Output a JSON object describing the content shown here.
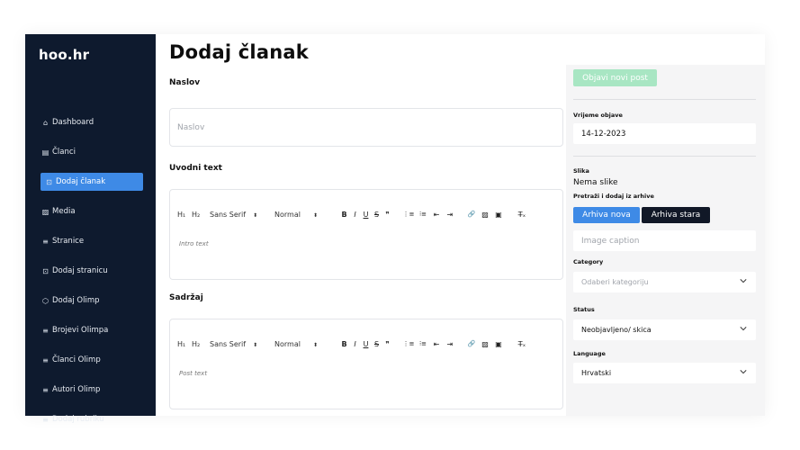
{
  "app": {
    "logo": "hoo.hr"
  },
  "sidebar": {
    "items": [
      {
        "label": "Dashboard",
        "icon": "home-icon",
        "glyph": "⌂"
      },
      {
        "label": "Članci",
        "icon": "article-icon",
        "glyph": "▤"
      },
      {
        "label": "Dodaj članak",
        "icon": "add-article-icon",
        "glyph": "⊡",
        "active": true
      },
      {
        "label": "Media",
        "icon": "image-icon",
        "glyph": "▨"
      },
      {
        "label": "Stranice",
        "icon": "list-icon",
        "glyph": "≡"
      },
      {
        "label": "Dodaj stranicu",
        "icon": "add-page-icon",
        "glyph": "⊡"
      },
      {
        "label": "Dodaj Olimp",
        "icon": "cube-icon",
        "glyph": "⬡"
      },
      {
        "label": "Brojevi Olimpa",
        "icon": "list-icon",
        "glyph": "≡"
      },
      {
        "label": "Članci Olimp",
        "icon": "list-icon",
        "glyph": "≡"
      },
      {
        "label": "Autori Olimp",
        "icon": "list-icon",
        "glyph": "≡"
      },
      {
        "label": "Dodaj rubriku",
        "icon": "list-icon",
        "glyph": "≡"
      }
    ]
  },
  "main": {
    "title": "Dodaj članak",
    "naslov_label": "Naslov",
    "naslov_placeholder": "Naslov",
    "uvodni_label": "Uvodni text",
    "uvodni_placeholder": "Intro text",
    "sadrzaj_label": "Sadržaj",
    "sadrzaj_placeholder": "Post text",
    "toolbar": {
      "h1": "H₁",
      "h2": "H₂",
      "font": "Sans Serif",
      "size": "Normal",
      "bold": "B",
      "italic": "I",
      "underline": "U",
      "strike": "S",
      "quote": "❞",
      "ordered_list": "⋮≡",
      "bullet_list": "⁝≡",
      "outdent": "⇤",
      "indent": "⇥",
      "link": "🔗",
      "image": "▨",
      "video": "▣",
      "clear": "T̶ₓ"
    }
  },
  "panel": {
    "publish_label": "Objavi novi post",
    "date_label": "Vrijeme objave",
    "date_value": "14-12-2023",
    "image_label": "Slika",
    "no_image": "Nema slike",
    "search_label": "Pretraži i dodaj iz arhive",
    "btn_new": "Arhiva nova",
    "btn_old": "Arhiva stara",
    "caption_placeholder": "Image caption",
    "category_label": "Category",
    "category_placeholder": "Odaberi kategoriju",
    "status_label": "Status",
    "status_value": "Neobjavljeno/ skica",
    "language_label": "Language",
    "language_value": "Hrvatski"
  },
  "colors": {
    "sidebar": "#0e1a2e",
    "accent": "#3e8ae6",
    "publish": "#a8e6c3",
    "dark_button": "#111827"
  }
}
